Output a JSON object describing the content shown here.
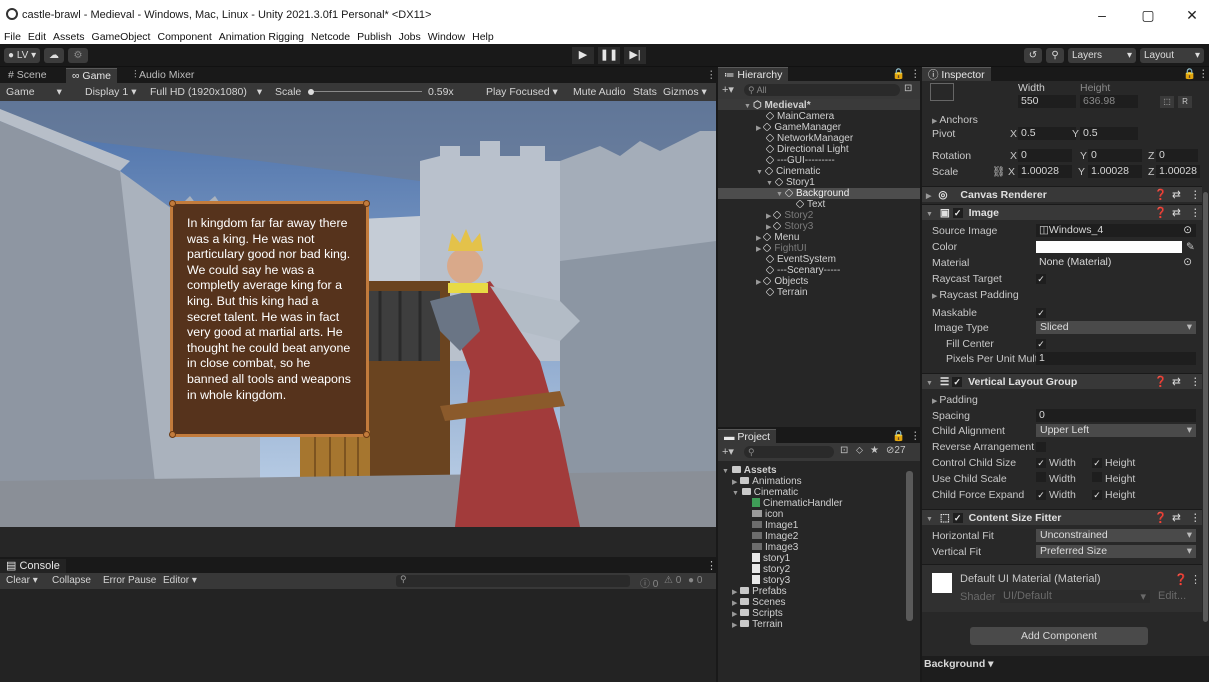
{
  "titlebar": {
    "title": "castle-brawl - Medieval - Windows, Mac, Linux - Unity 2021.3.0f1 Personal* <DX11>",
    "minimize": "–",
    "maximize": "▢",
    "close": "✕"
  },
  "menu": [
    "File",
    "Edit",
    "Assets",
    "GameObject",
    "Component",
    "Animation Rigging",
    "Netcode",
    "Publish",
    "Jobs",
    "Window",
    "Help"
  ],
  "toolbar": {
    "account": "LV ▾",
    "layers": "Layers",
    "layout": "Layout"
  },
  "game": {
    "tabs": [
      "# Scene",
      "Game",
      "Audio Mixer"
    ],
    "mode": "Game",
    "display": "Display 1",
    "resolution": "Full HD (1920x1080)",
    "scale_label": "Scale",
    "scale_value": "0.59x",
    "play_focused": "Play Focused",
    "mute": "Mute Audio",
    "stats": "Stats",
    "gizmos": "Gizmos",
    "dialog_text": "In kingdom far far away there was a king. He was not particulary good nor bad king. We could say he was a completly average king for a king. But this king had a secret talent. He was in fact very good at martial arts. He thought he could beat anyone in close combat, so he banned all tools and weapons in whole kingdom."
  },
  "console": {
    "tab": "Console",
    "clear": "Clear",
    "collapse": "Collapse",
    "error_pause": "Error Pause",
    "editor": "Editor",
    "errors": "0",
    "warnings": "0",
    "messages": "0"
  },
  "hierarchy": {
    "tab": "Hierarchy",
    "search_placeholder": "All",
    "items": [
      {
        "label": "Medieval*"
      },
      {
        "label": "MainCamera"
      },
      {
        "label": "GameManager"
      },
      {
        "label": "NetworkManager"
      },
      {
        "label": "Directional Light"
      },
      {
        "label": "---GUI---------"
      },
      {
        "label": "Cinematic"
      },
      {
        "label": "Story1"
      },
      {
        "label": "Background"
      },
      {
        "label": "Text"
      },
      {
        "label": "Story2"
      },
      {
        "label": "Story3"
      },
      {
        "label": "Menu"
      },
      {
        "label": "FightUI"
      },
      {
        "label": "EventSystem"
      },
      {
        "label": "---Scenary-----"
      },
      {
        "label": "Objects"
      },
      {
        "label": "Terrain"
      }
    ]
  },
  "project": {
    "tab": "Project",
    "count": "27",
    "items": [
      {
        "label": "Assets"
      },
      {
        "label": "Animations"
      },
      {
        "label": "Cinematic"
      },
      {
        "label": "CinematicHandler"
      },
      {
        "label": "icon"
      },
      {
        "label": "Image1"
      },
      {
        "label": "Image2"
      },
      {
        "label": "Image3"
      },
      {
        "label": "story1"
      },
      {
        "label": "story2"
      },
      {
        "label": "story3"
      },
      {
        "label": "Prefabs"
      },
      {
        "label": "Scenes"
      },
      {
        "label": "Scripts"
      },
      {
        "label": "Terrain"
      }
    ]
  },
  "inspector": {
    "tab": "Inspector",
    "width_label": "Width",
    "height_label": "Height",
    "width": "550",
    "height": "636.98",
    "anchors": "Anchors",
    "pivot": "Pivot",
    "pivot_x": "0.5",
    "pivot_y": "0.5",
    "rotation": "Rotation",
    "rot_x": "0",
    "rot_y": "0",
    "rot_z": "0",
    "scale": "Scale",
    "scale_x": "1.00028",
    "scale_y": "1.00028",
    "scale_z": "1.00028",
    "canvas_renderer": "Canvas Renderer",
    "image": "Image",
    "source_image": "Source Image",
    "source_image_value": "Windows_4",
    "color": "Color",
    "material": "Material",
    "material_value": "None (Material)",
    "raycast_target": "Raycast Target",
    "raycast_padding": "Raycast Padding",
    "maskable": "Maskable",
    "image_type": "Image Type",
    "image_type_value": "Sliced",
    "fill_center": "Fill Center",
    "ppu": "Pixels Per Unit Mult",
    "ppu_value": "1",
    "vlg": "Vertical Layout Group",
    "padding": "Padding",
    "spacing": "Spacing",
    "spacing_value": "0",
    "child_alignment": "Child Alignment",
    "child_alignment_value": "Upper Left",
    "reverse": "Reverse Arrangement",
    "control_child_size": "Control Child Size",
    "use_child_scale": "Use Child Scale",
    "child_force_expand": "Child Force Expand",
    "width_word": "Width",
    "height_word": "Height",
    "csf": "Content Size Fitter",
    "horizontal_fit": "Horizontal Fit",
    "horizontal_fit_value": "Unconstrained",
    "vertical_fit": "Vertical Fit",
    "vertical_fit_value": "Preferred Size",
    "default_material": "Default UI Material (Material)",
    "shader": "Shader",
    "shader_value": "UI/Default",
    "edit": "Edit...",
    "add_component": "Add Component",
    "background": "Background"
  }
}
